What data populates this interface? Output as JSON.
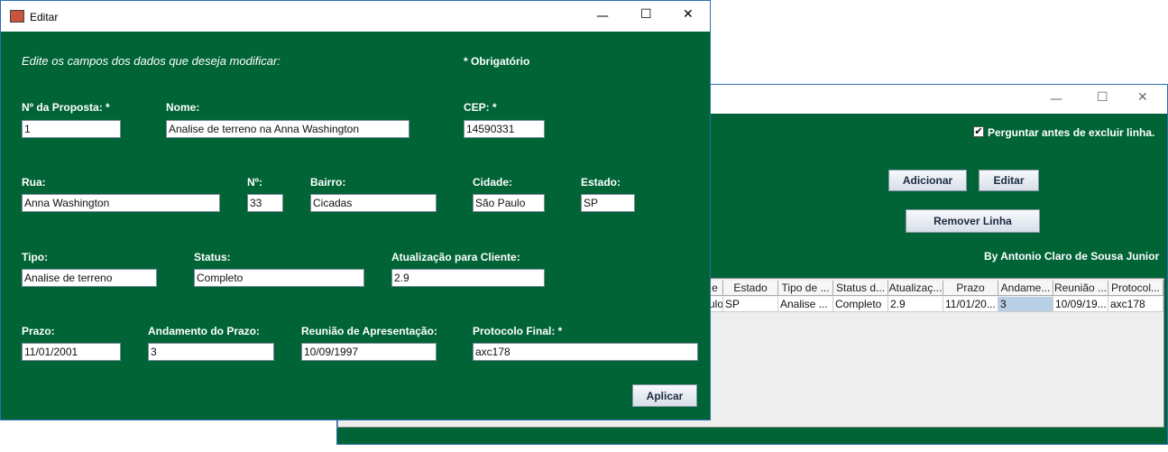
{
  "back_window": {
    "confirm_delete_label": "Perguntar antes de excluir linha.",
    "add_button": "Adicionar",
    "edit_button": "Editar",
    "remove_button": "Remover Linha",
    "author": "By Antonio Claro de Sousa Junior",
    "table": {
      "headers": [
        "e",
        "Estado",
        "Tipo de ...",
        "Status d...",
        "Atualizaç...",
        "Prazo",
        "Andame...",
        "Reunião ...",
        "Protocol..."
      ],
      "row": [
        "ulo",
        "SP",
        "Analise ...",
        "Completo",
        "2.9",
        "11/01/20...",
        "3",
        "10/09/19...",
        "axc178"
      ]
    }
  },
  "front_window": {
    "title": "Editar",
    "instructions": "Edite os campos dos dados que deseja modificar:",
    "required_note": "* Obrigatório",
    "fields": {
      "proposta": {
        "label": "Nº da Proposta:  *",
        "value": "1"
      },
      "nome": {
        "label": "Nome:",
        "value": "Analise de terreno na Anna Washington"
      },
      "cep": {
        "label": "CEP:  *",
        "value": "14590331"
      },
      "rua": {
        "label": "Rua:",
        "value": "Anna Washington"
      },
      "numero": {
        "label": "Nº:",
        "value": "33"
      },
      "bairro": {
        "label": "Bairro:",
        "value": "Cicadas"
      },
      "cidade": {
        "label": "Cidade:",
        "value": "São Paulo"
      },
      "estado": {
        "label": "Estado:",
        "value": "SP"
      },
      "tipo": {
        "label": "Tipo:",
        "value": "Analise de terreno"
      },
      "status": {
        "label": "Status:",
        "value": "Completo"
      },
      "atualizacao": {
        "label": "Atualização para Cliente:",
        "value": "2.9"
      },
      "prazo": {
        "label": "Prazo:",
        "value": "11/01/2001"
      },
      "andamento": {
        "label": "Andamento do Prazo:",
        "value": "3"
      },
      "reuniao": {
        "label": "Reunião de Apresentação:",
        "value": "10/09/1997"
      },
      "protocolo": {
        "label": "Protocolo Final:  *",
        "value": "axc178"
      }
    },
    "apply_button": "Aplicar"
  },
  "colors": {
    "panel_green": "#006437",
    "title_bar": "#ffffff",
    "window_border": "#2b6fb5"
  }
}
